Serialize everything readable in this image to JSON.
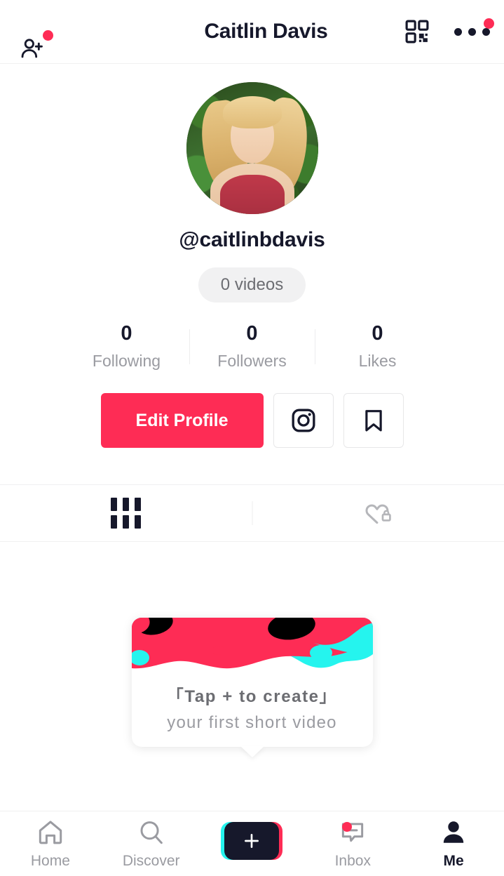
{
  "header": {
    "title": "Caitlin Davis",
    "add_friend_icon": "person-add-icon",
    "qr_icon": "qr-code-icon",
    "more_icon": "more-options-icon",
    "badge_color": "#fe2c55",
    "has_add_friend_badge": true,
    "has_more_badge": true
  },
  "profile": {
    "avatar_alt": "profile-photo",
    "handle": "@caitlinbdavis",
    "videos_pill": "0 videos",
    "stats": [
      {
        "value": "0",
        "label": "Following"
      },
      {
        "value": "0",
        "label": "Followers"
      },
      {
        "value": "0",
        "label": "Likes"
      }
    ]
  },
  "actions": {
    "edit_label": "Edit Profile",
    "edit_color": "#fe2c55",
    "instagram_icon": "instagram-icon",
    "bookmark_icon": "bookmark-icon"
  },
  "tabs": [
    {
      "icon": "grid-posts-icon",
      "active": true
    },
    {
      "icon": "private-likes-heart-lock-icon",
      "active": false
    }
  ],
  "tip_card": {
    "line1": "「Tap + to create」",
    "line2": "your first short video",
    "art_colors": {
      "cyan": "#25f4ee",
      "red": "#fe2c55",
      "black": "#000000"
    }
  },
  "bottom_nav": [
    {
      "label": "Home",
      "icon": "home-icon",
      "active": false,
      "badge": false
    },
    {
      "label": "Discover",
      "icon": "search-icon",
      "active": false,
      "badge": false
    },
    {
      "label": "",
      "icon": "create-plus-icon",
      "active": false,
      "badge": false
    },
    {
      "label": "Inbox",
      "icon": "inbox-message-icon",
      "active": false,
      "badge": true
    },
    {
      "label": "Me",
      "icon": "person-icon",
      "active": true,
      "badge": false
    }
  ]
}
